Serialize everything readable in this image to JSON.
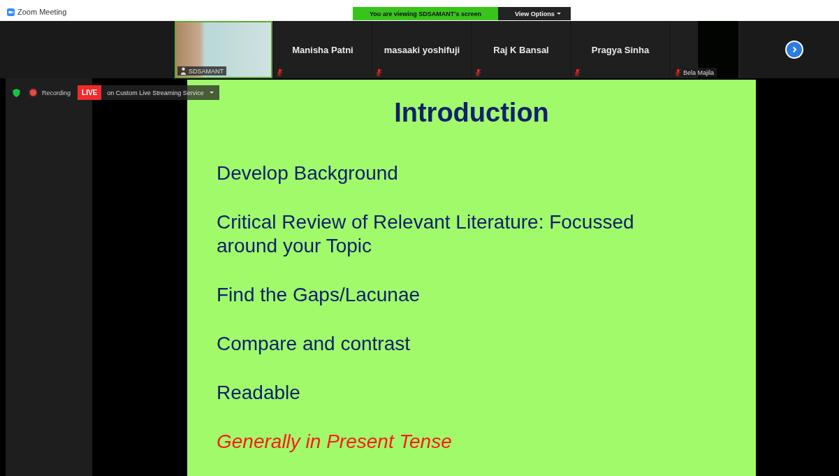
{
  "window": {
    "title": "Zoom Meeting"
  },
  "share_banner": {
    "text": "You are viewing SDSAMANT's screen",
    "view_options": "View Options"
  },
  "participants": [
    {
      "name": "SDSAMANT",
      "kind": "video",
      "muted": false,
      "speaking": true
    },
    {
      "name": "Manisha Patni",
      "kind": "name",
      "muted": true,
      "speaking": false
    },
    {
      "name": "masaaki yoshifuji",
      "kind": "name",
      "muted": true,
      "speaking": false
    },
    {
      "name": "Raj K Bansal",
      "kind": "name",
      "muted": true,
      "speaking": false
    },
    {
      "name": "Pragya Sinha",
      "kind": "name",
      "muted": true,
      "speaking": false
    },
    {
      "name": "Bela Majila",
      "kind": "dark-video",
      "muted": true,
      "speaking": false
    }
  ],
  "status": {
    "recording": "Recording",
    "live": "LIVE",
    "stream": "on Custom Live Streaming Service"
  },
  "slide": {
    "title": "Introduction",
    "points": [
      {
        "text": "Develop Background",
        "kind": "point"
      },
      {
        "text": "Critical Review of Relevant Literature: Focussed around your Topic",
        "kind": "point"
      },
      {
        "text": "Find the Gaps/Lacunae",
        "kind": "point"
      },
      {
        "text": "Compare and contrast",
        "kind": "point"
      },
      {
        "text": "Readable",
        "kind": "point"
      },
      {
        "text": "Generally in Present Tense",
        "kind": "highlight"
      }
    ]
  }
}
